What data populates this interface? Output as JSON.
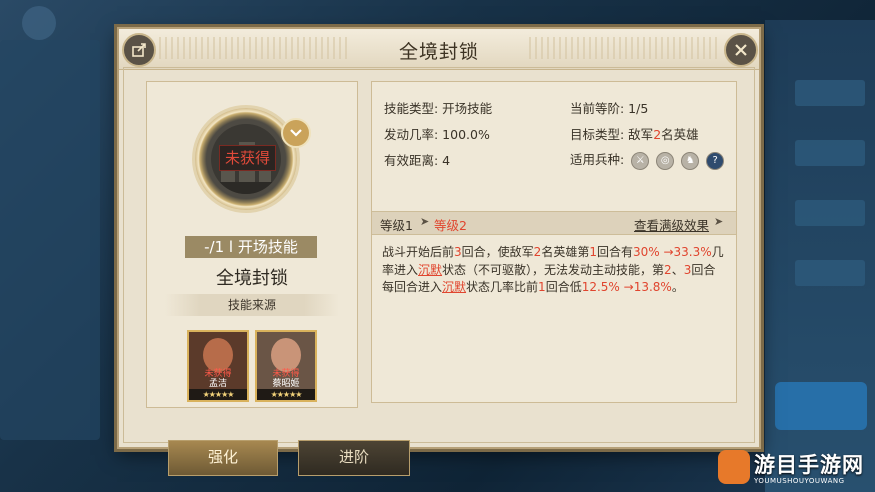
{
  "dialog": {
    "title": "全境封锁"
  },
  "skill_card": {
    "status_overlay": "未获得",
    "level_tag": "-/1 l 开场技能",
    "name": "全境封锁",
    "source_label": "技能来源",
    "heroes": [
      {
        "status": "未获得",
        "name": "孟洁",
        "stars": "★★★★★"
      },
      {
        "status": "未获得",
        "name": "蔡昭姬",
        "stars": "★★★★★"
      }
    ]
  },
  "attributes": {
    "skill_type": "技能类型: 开场技能",
    "current_tier": "当前等阶: 1/5",
    "trigger_rate": "发动几率: 100.0%",
    "target_type_prefix": "目标类型: 敌军",
    "target_count": "2",
    "target_type_suffix": "名英雄",
    "range": "有效距离: 4",
    "troop_types_label": "适用兵种:",
    "troop_icons": [
      "sword-icon",
      "target-icon",
      "horse-icon",
      "question-icon"
    ]
  },
  "level": {
    "from": "等级1",
    "arrow": "➤",
    "to": "等级2",
    "view_max": "查看满级效果",
    "view_max_arrow": "➤"
  },
  "description": {
    "p1": "战斗开始后前",
    "n1": "3",
    "p2": "回合，使敌军",
    "n2": "2",
    "p3": "名英雄第",
    "n3": "1",
    "p4": "回合有",
    "v1": "30% →33.3%",
    "p5": "几率进入",
    "s1": "沉默",
    "p6": "状态（不可驱散），无法发动主动技能，第",
    "n4": "2",
    "p7": "、",
    "n5": "3",
    "p8": "回合每回合进入",
    "s2": "沉默",
    "p9": "状态几率比前",
    "n6": "1",
    "p10": "回合低",
    "v2": "12.5% →13.8%",
    "p11": "。"
  },
  "tabs": {
    "strengthen": "强化",
    "advance": "进阶"
  },
  "watermark": {
    "text": "游目手游网",
    "sub": "YOUMUSHOUYOUWANG"
  },
  "colors": {
    "highlight": "#e0452e",
    "panel_bg": "#e9e1cf",
    "accent_gold": "#caa35a"
  }
}
